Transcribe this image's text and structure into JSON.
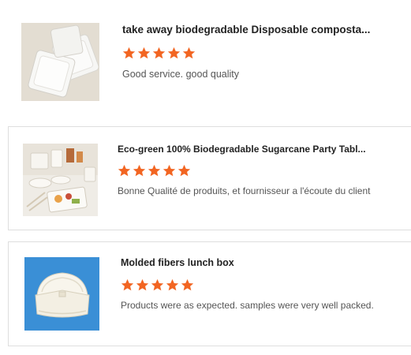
{
  "colors": {
    "star": "#f26522",
    "border": "#dedede",
    "title": "#222222",
    "review": "#555555"
  },
  "reviews": [
    {
      "title": "take away biodegradable Disposable composta...",
      "rating": 5,
      "rating_max": 5,
      "comment": "Good service. good quality",
      "image": "square-plates-image"
    },
    {
      "title": "Eco-green 100% Biodegradable Sugarcane Party Tabl...",
      "rating": 5,
      "rating_max": 5,
      "comment": "Bonne Qualité de produits, et fournisseur a l'écoute du client",
      "image": "party-tableware-image"
    },
    {
      "title": "Molded fibers lunch box",
      "rating": 5,
      "rating_max": 5,
      "comment": "Products were as expected. samples were very well packed.",
      "image": "clamshell-box-image"
    }
  ]
}
